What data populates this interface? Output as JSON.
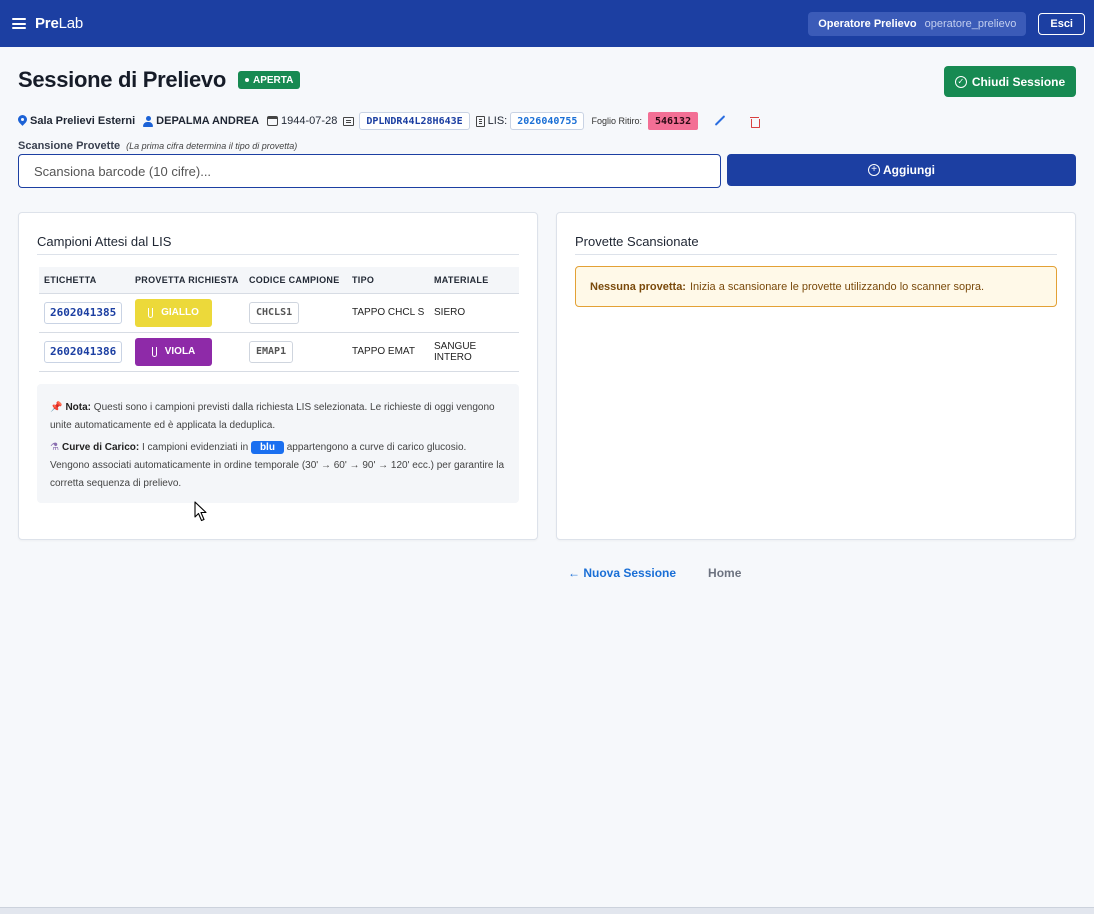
{
  "navbar": {
    "brand_bold": "Pre",
    "brand_light": "Lab",
    "user_role": "Operatore Prelievo",
    "username": "operatore_prelievo",
    "logout_label": "Esci"
  },
  "header": {
    "title": "Sessione di Prelievo",
    "status": "APERTA",
    "close_button": "Chiudi Sessione"
  },
  "info": {
    "location": "Sala Prelievi Esterni",
    "patient": "DEPALMA ANDREA",
    "birth_date": "1944-07-28",
    "fiscal_code": "DPLNDR44L28H643E",
    "lis_label": "LIS:",
    "lis_code": "2026040755",
    "foglio_label": "Foglio Ritiro:",
    "foglio_code": "546132"
  },
  "scan": {
    "label": "Scansione Provette",
    "hint": "(La prima cifra determina il tipo di provetta)",
    "placeholder": "Scansiona barcode (10 cifre)...",
    "add_button": "Aggiungi"
  },
  "expected": {
    "title": "Campioni Attesi dal LIS",
    "columns": [
      "ETICHETTA",
      "PROVETTA RICHIESTA",
      "CODICE CAMPIONE",
      "TIPO",
      "MATERIALE"
    ],
    "rows": [
      {
        "label": "2602041385",
        "tube": "GIALLO",
        "tube_color": "#ecd93a",
        "code": "CHCLS1",
        "type": "TAPPO CHCL S",
        "material": "SIERO"
      },
      {
        "label": "2602041386",
        "tube": "VIOLA",
        "tube_color": "#8e2aa8",
        "code": "EMAP1",
        "type": "TAPPO EMAT",
        "material": "SANGUE INTERO"
      }
    ],
    "note": {
      "title": "Nota:",
      "text": "Questi sono i campioni previsti dalla richiesta LIS selezionata. Le richieste di oggi vengono unite automaticamente ed è applicata la deduplica.",
      "curves_title": "Curve di Carico:",
      "curves_text_1": "I campioni evidenziati in",
      "curves_highlight": "blu",
      "curves_text_2": "appartengono a curve di carico glucosio. Vengono associati automaticamente in ordine temporale (30' → 60' → 90' → 120' ecc.) per garantire la corretta sequenza di prelievo."
    }
  },
  "scanned": {
    "title": "Provette Scansionate",
    "empty_title": "Nessuna provetta:",
    "empty_text": "Inizia a scansionare le provette utilizzando lo scanner sopra."
  },
  "footer": {
    "new_session": "← Nuova Sessione",
    "home": "Home"
  },
  "colors": {
    "primary": "#1c3fa2",
    "success": "#178a52",
    "foglio": "#f36f95",
    "highlight_blue": "#1a6ff0"
  }
}
